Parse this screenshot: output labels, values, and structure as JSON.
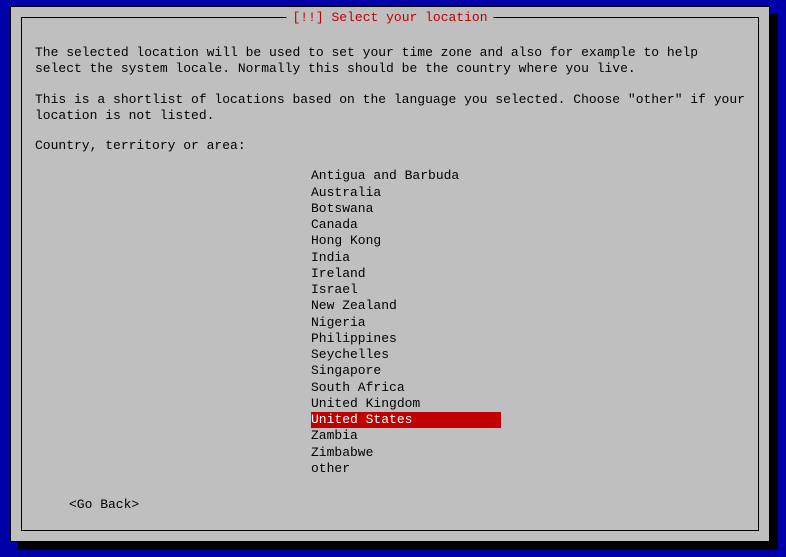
{
  "title": "[!!] Select your location",
  "paragraph1": "The selected location will be used to set your time zone and also for example to help select the system locale. Normally this should be the country where you live.",
  "paragraph2": "This is a shortlist of locations based on the language you selected. Choose \"other\" if your location is not listed.",
  "prompt": "Country, territory or area:",
  "items": [
    "Antigua and Barbuda",
    "Australia",
    "Botswana",
    "Canada",
    "Hong Kong",
    "India",
    "Ireland",
    "Israel",
    "New Zealand",
    "Nigeria",
    "Philippines",
    "Seychelles",
    "Singapore",
    "South Africa",
    "United Kingdom",
    "United States",
    "Zambia",
    "Zimbabwe",
    "other"
  ],
  "selected_index": 15,
  "go_back": "<Go Back>"
}
